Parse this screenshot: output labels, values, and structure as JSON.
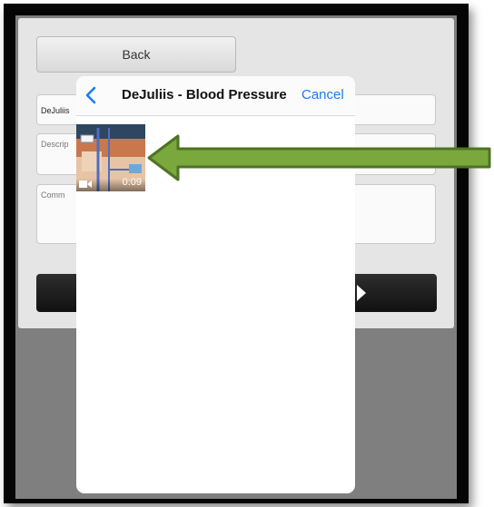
{
  "form": {
    "back_label": "Back",
    "name_value": "DeJuliis",
    "description_placeholder": "Descrip",
    "comment_placeholder": "Comm"
  },
  "picker": {
    "title": "DeJuliis - Blood Pressure",
    "cancel_label": "Cancel",
    "videos": [
      {
        "duration": "0:09"
      }
    ]
  },
  "colors": {
    "ios_blue": "#1a7cf2",
    "arrow_green": "#7aa83c",
    "arrow_outline": "#4e7324"
  },
  "icons": {
    "back": "chevron-left-icon",
    "video": "video-camera-icon"
  }
}
